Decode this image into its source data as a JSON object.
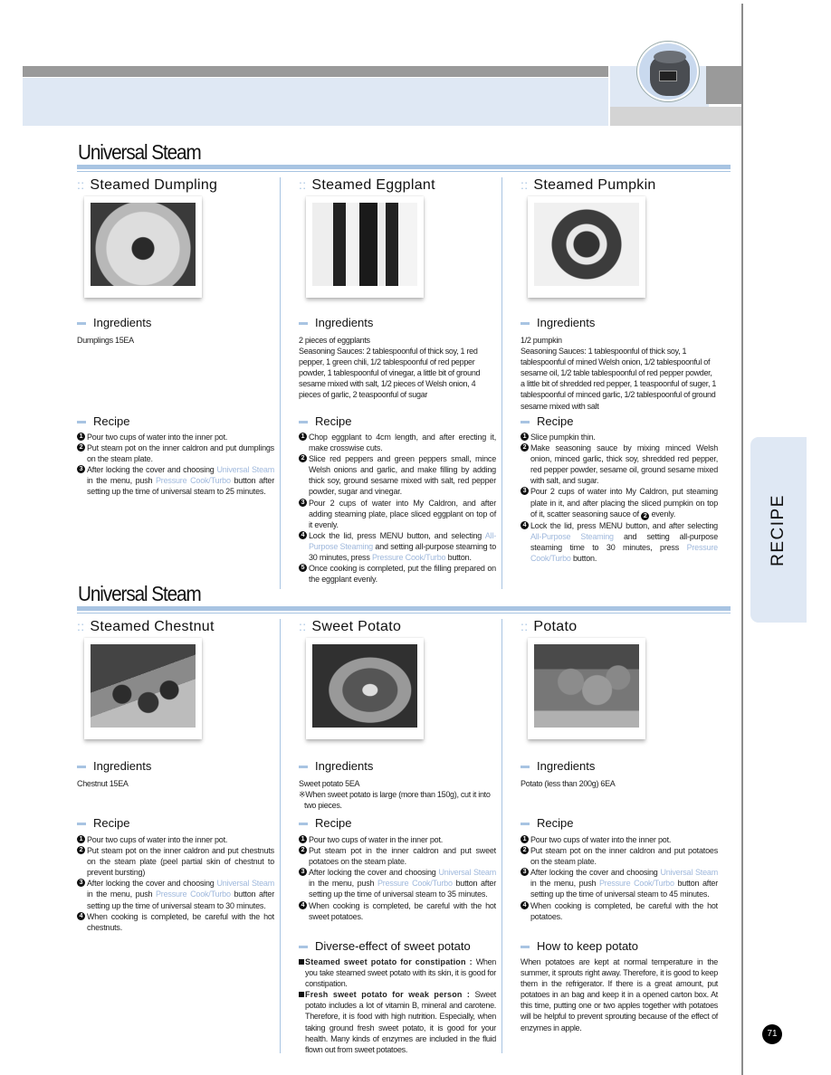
{
  "page": {
    "number": "71",
    "side_tab": "RECIPE"
  },
  "sections": [
    {
      "title": "Universal Steam",
      "dishes": [
        {
          "title": "Steamed Dumpling",
          "photo": "steamed-dumpling-photo",
          "ingredients_label": "Ingredients",
          "ingredients": [
            "Dumplings 15EA"
          ],
          "recipe_label": "Recipe",
          "steps": [
            {
              "num": "1",
              "parts": [
                {
                  "t": "Pour two cups of water into the inner pot."
                }
              ]
            },
            {
              "num": "2",
              "parts": [
                {
                  "t": "Put steam pot on the inner caldron and put dumplings on the steam plate."
                }
              ]
            },
            {
              "num": "3",
              "parts": [
                {
                  "t": "After locking the cover and choosing "
                },
                {
                  "t": "Universal Steam",
                  "hl": true
                },
                {
                  "t": " in the menu, push "
                },
                {
                  "t": "Pressure Cook/Turbo",
                  "hl": true
                },
                {
                  "t": " button after setting up the time of universal steam to 25 minutes."
                }
              ]
            }
          ]
        },
        {
          "title": "Steamed Eggplant",
          "photo": "steamed-eggplant-photo",
          "ingredients_label": "Ingredients",
          "ingredients": [
            "2 pieces of eggplants",
            "Seasoning Sauces: 2 tablespoonful of thick soy, 1 red pepper, 1 green chili, 1/2 tablespoonful of red pepper powder, 1 tablespoonful of vinegar, a little bit of ground sesame mixed with salt, 1/2 pieces of Welsh onion, 4 pieces of garlic, 2 teaspoonful of sugar"
          ],
          "recipe_label": "Recipe",
          "steps": [
            {
              "num": "1",
              "parts": [
                {
                  "t": "Chop eggplant to 4cm length, and after erecting it, make crosswise cuts."
                }
              ]
            },
            {
              "num": "2",
              "parts": [
                {
                  "t": "Slice red peppers and green peppers small, mince Welsh onions and garlic, and make filling by adding thick soy, ground sesame mixed with salt, red pepper powder, sugar and vinegar."
                }
              ]
            },
            {
              "num": "3",
              "parts": [
                {
                  "t": "Pour 2 cups of water into My Caldron, and after adding steaming plate, place sliced eggplant on top of it evenly."
                }
              ]
            },
            {
              "num": "4",
              "parts": [
                {
                  "t": "Lock the lid, press MENU button, and selecting "
                },
                {
                  "t": "All-Purpose Steaming",
                  "hl": true
                },
                {
                  "t": " and setting all-purpose steaming to 30 minutes, press "
                },
                {
                  "t": "Pressure Cook/Turbo",
                  "hl": true
                },
                {
                  "t": " button."
                }
              ]
            },
            {
              "num": "5",
              "parts": [
                {
                  "t": "Once cooking is completed, put the filling prepared on the eggplant evenly."
                }
              ]
            }
          ]
        },
        {
          "title": "Steamed Pumpkin",
          "photo": "steamed-pumpkin-photo",
          "ingredients_label": "Ingredients",
          "ingredients": [
            "1/2 pumpkin",
            "Seasoning Sauces: 1 tablespoonful of thick soy, 1 tablespoonful of mined Welsh onion, 1/2 tablespoonful of sesame oil, 1/2 table tablespoonful of red pepper powder, a little bit of shredded red pepper, 1 teaspoonful of suger, 1 tablespoonful of minced garlic, 1/2 tablespoonful of ground sesame mixed with salt"
          ],
          "recipe_label": "Recipe",
          "steps": [
            {
              "num": "1",
              "parts": [
                {
                  "t": "Slice pumpkin thin."
                }
              ]
            },
            {
              "num": "2",
              "parts": [
                {
                  "t": "Make seasoning sauce by mixing minced Welsh onion, minced garlic, thick soy, shredded red pepper, red pepper powder, sesame oil, ground sesame mixed with salt, and sugar."
                }
              ]
            },
            {
              "num": "3",
              "parts": [
                {
                  "t": "Pour 2 cups of water into My Caldron, put steaming plate in it, and after placing the sliced pumpkin on top of it, scatter seasoning sauce of "
                },
                {
                  "ref": "2"
                },
                {
                  "t": " evenly."
                }
              ]
            },
            {
              "num": "4",
              "parts": [
                {
                  "t": "Lock the lid, press MENU button, and after selecting "
                },
                {
                  "t": "All-Purpose Steaming",
                  "hl": true
                },
                {
                  "t": " and setting all-purpose steaming time to 30 minutes, press "
                },
                {
                  "t": "Pressure Cook/Turbo",
                  "hl": true
                },
                {
                  "t": " button."
                }
              ]
            }
          ]
        }
      ]
    },
    {
      "title": "Universal Steam",
      "dishes": [
        {
          "title": "Steamed Chestnut",
          "photo": "steamed-chestnut-photo",
          "ingredients_label": "Ingredients",
          "ingredients": [
            "Chestnut 15EA"
          ],
          "recipe_label": "Recipe",
          "steps": [
            {
              "num": "1",
              "parts": [
                {
                  "t": "Pour two cups of water into the inner pot."
                }
              ]
            },
            {
              "num": "2",
              "parts": [
                {
                  "t": "Put steam pot on the inner caldron and put chestnuts on the steam plate (peel partial skin of chestnut to prevent bursting)"
                }
              ]
            },
            {
              "num": "3",
              "parts": [
                {
                  "t": "After locking the cover and choosing "
                },
                {
                  "t": "Universal Steam",
                  "hl": true
                },
                {
                  "t": " in the menu, push "
                },
                {
                  "t": "Pressure Cook/Turbo",
                  "hl": true
                },
                {
                  "t": " button after setting up the time of universal steam to 30 minutes."
                }
              ]
            },
            {
              "num": "4",
              "parts": [
                {
                  "t": "When cooking is completed, be careful with the hot chestnuts."
                }
              ]
            }
          ]
        },
        {
          "title": "Sweet Potato",
          "photo": "sweet-potato-photo",
          "ingredients_label": "Ingredients",
          "ingredients": [
            "Sweet potato 5EA",
            "※When sweet potato is large (more than 150g), cut it into two pieces."
          ],
          "recipe_label": "Recipe",
          "steps": [
            {
              "num": "1",
              "parts": [
                {
                  "t": "Pour two cups of water in the inner pot."
                }
              ]
            },
            {
              "num": "2",
              "parts": [
                {
                  "t": "Put steam pot in the inner caldron and put sweet potatoes on the steam plate."
                }
              ]
            },
            {
              "num": "3",
              "parts": [
                {
                  "t": "After locking the cover and choosing "
                },
                {
                  "t": "Universal Steam",
                  "hl": true
                },
                {
                  "t": " in the menu, push "
                },
                {
                  "t": "Pressure Cook/Turbo",
                  "hl": true
                },
                {
                  "t": " button after setting up the time of universal steam to 35 minutes."
                }
              ]
            },
            {
              "num": "4",
              "parts": [
                {
                  "t": "When cooking is completed, be careful with the hot sweet potatoes."
                }
              ]
            }
          ],
          "extra": {
            "label": "Diverse-effect of sweet potato",
            "bullets": [
              {
                "bold": "Steamed sweet potato for constipation : ",
                "text": "When you take steamed sweet potato with its skin, it is good for constipation."
              },
              {
                "bold": "Fresh sweet potato for weak person : ",
                "text": "Sweet potato includes a lot of vitamin B, mineral and carotene. Therefore, it is food with high nutrition. Especially, when taking ground fresh sweet potato, it is good for your health. Many kinds of enzymes are included in the fluid flown out from sweet potatoes."
              }
            ]
          }
        },
        {
          "title": "Potato",
          "photo": "potato-photo",
          "ingredients_label": "Ingredients",
          "ingredients": [
            "Potato (less than 200g) 6EA"
          ],
          "recipe_label": "Recipe",
          "steps": [
            {
              "num": "1",
              "parts": [
                {
                  "t": "Pour two cups of water into the inner pot."
                }
              ]
            },
            {
              "num": "2",
              "parts": [
                {
                  "t": "Put steam pot on the inner caldron and put potatoes on the steam plate."
                }
              ]
            },
            {
              "num": "3",
              "parts": [
                {
                  "t": "After locking the cover and choosing "
                },
                {
                  "t": "Universal Steam",
                  "hl": true
                },
                {
                  "t": " in the menu, push "
                },
                {
                  "t": "Pressure Cook/Turbo",
                  "hl": true
                },
                {
                  "t": " button after setting up the time of universal steam to 45 minutes."
                }
              ]
            },
            {
              "num": "4",
              "parts": [
                {
                  "t": "When cooking is completed, be careful with the hot potatoes."
                }
              ]
            }
          ],
          "extra": {
            "label": "How to keep potato",
            "text": "When potatoes are kept at normal temperature in the summer, it sprouts right away. Therefore, it is good to keep them in the refrigerator. If there is a great amount, put potatoes in an bag and keep it in a opened carton box. At this time, putting one or two apples together with potatoes will be helpful to prevent sprouting because of the effect of enzymes in apple."
          }
        }
      ]
    }
  ]
}
